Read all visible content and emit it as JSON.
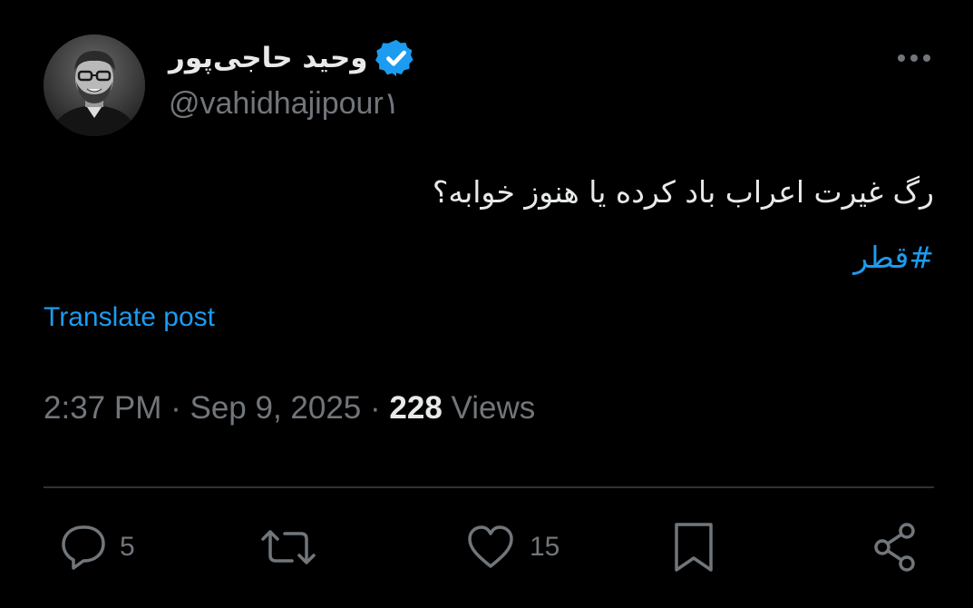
{
  "author": {
    "display_name": "وحید حاجی‌پور",
    "handle": "@vahidhajipour١",
    "verified": true,
    "avatar_icon": "profile-photo"
  },
  "menu": {
    "more_icon": "more-horizontal-icon"
  },
  "post": {
    "text": "رگ غیرت اعراب باد کرده یا هنوز خوابه؟",
    "hashtag": "#قطر",
    "translate_label": "Translate post"
  },
  "meta": {
    "time": "2:37 PM",
    "separator": "·",
    "date": "Sep 9, 2025",
    "views_count": "228",
    "views_label": "Views"
  },
  "actions": {
    "replies": "5",
    "reposts": "",
    "likes": "15"
  },
  "colors": {
    "background": "#000000",
    "primary_text": "#e7e9ea",
    "secondary_text": "#71767b",
    "accent": "#1d9bf0",
    "divider": "#2f3336"
  }
}
